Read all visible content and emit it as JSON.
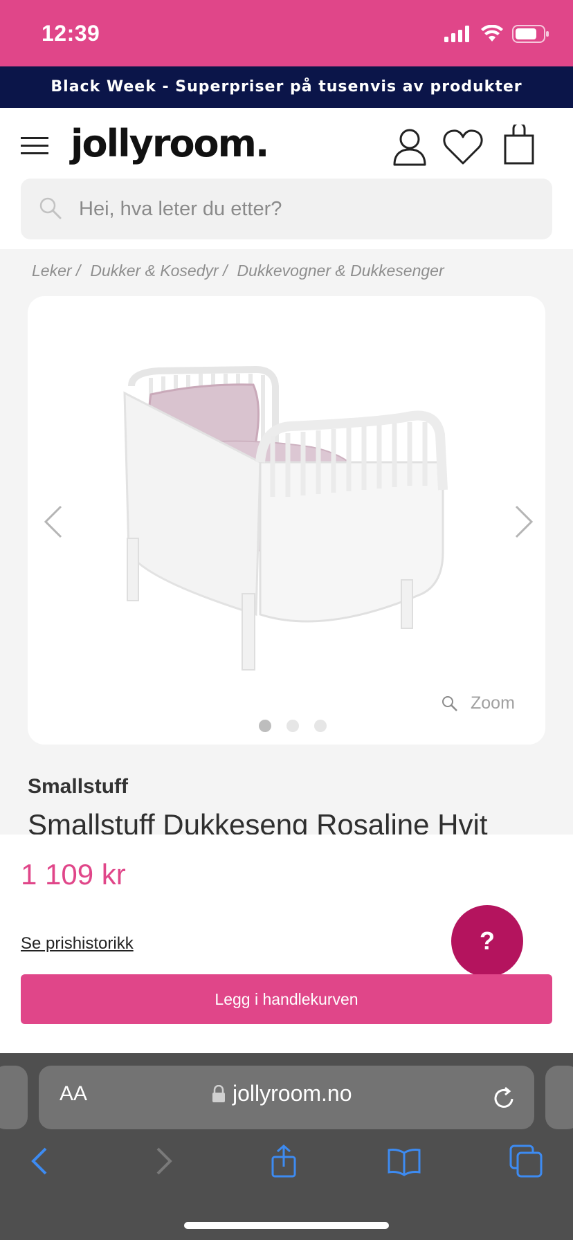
{
  "status_bar": {
    "time": "12:39"
  },
  "promo": {
    "text": "Black Week - Superpriser på tusenvis av produkter"
  },
  "header": {
    "logo": "jollyroom.",
    "search_placeholder": "Hei, hva leter du etter?"
  },
  "breadcrumb": [
    {
      "label": "Leker /"
    },
    {
      "label": "Dukker & Kosedyr /"
    },
    {
      "label": "Dukkevogner & Dukkesenger"
    }
  ],
  "gallery": {
    "zoom_label": "Zoom",
    "dot_count": 3,
    "active_dot": 0
  },
  "product": {
    "brand": "Smallstuff",
    "title": "Smallstuff Dukkeseng Rosaline Hvit",
    "price": "1 109 kr",
    "price_history_link": "Se prishistorikk",
    "add_to_cart": "Legg i handlekurven",
    "help_label": "?"
  },
  "browser": {
    "aa_label": "AA",
    "url": "jollyroom.no"
  },
  "colors": {
    "brand_pink": "#e04689",
    "banner_navy": "#0b1549",
    "help_magenta": "#b4145e",
    "safari_blue": "#3d8bf2"
  }
}
